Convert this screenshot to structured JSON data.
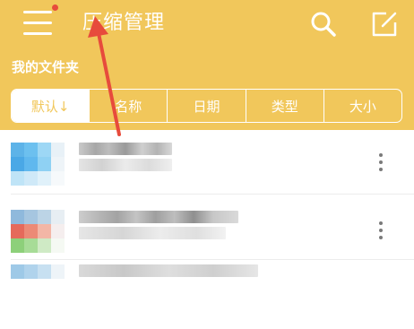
{
  "header": {
    "title": "压缩管理",
    "menu_icon": "hamburger-menu-icon",
    "notification_dot_color": "#e74b3c",
    "search_icon": "search-icon",
    "edit_icon": "edit-icon"
  },
  "section": {
    "title": "我的文件夹"
  },
  "sort_tabs": [
    {
      "label": "默认↓",
      "active": true
    },
    {
      "label": "名称",
      "active": false
    },
    {
      "label": "日期",
      "active": false
    },
    {
      "label": "类型",
      "active": false
    },
    {
      "label": "大小",
      "active": false
    }
  ],
  "colors": {
    "header": "#f1c75b",
    "accent_text": "#f1c75b",
    "annotation_arrow": "#e74b3c"
  },
  "files": [
    {
      "name_pixelated": true,
      "more_icon": "more-vertical-icon"
    },
    {
      "name_pixelated": true,
      "more_icon": "more-vertical-icon"
    },
    {
      "name_pixelated": true,
      "more_icon": "more-vertical-icon"
    }
  ]
}
